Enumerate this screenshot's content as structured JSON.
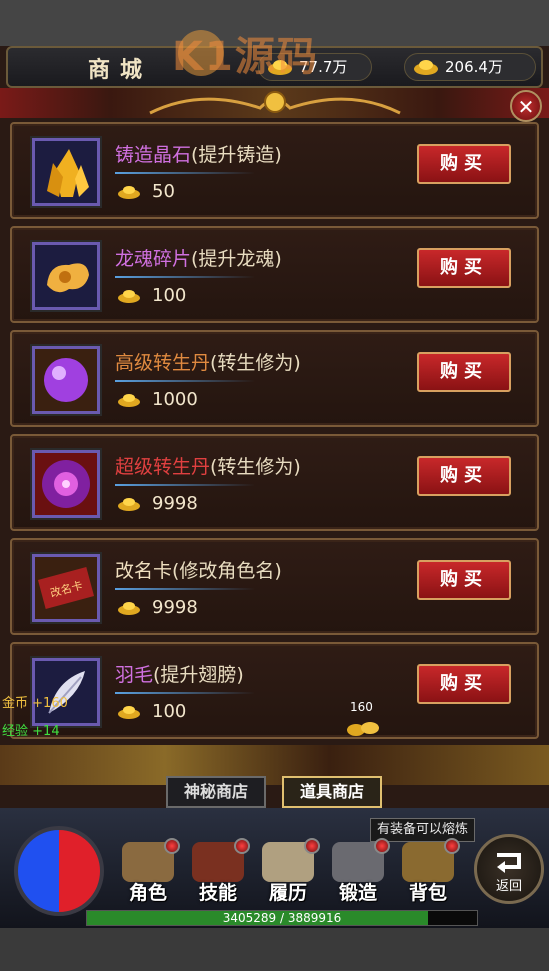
{
  "header": {
    "title": "商城",
    "gold_left": "77.7万",
    "gold_right": "206.4万",
    "watermark": "K1源码"
  },
  "items": [
    {
      "name": "铸造晶石",
      "desc": "(提升铸造)",
      "price": "50",
      "buy": "购买",
      "name_color": "#d070e0",
      "icon": "crystal-icon"
    },
    {
      "name": "龙魂碎片",
      "desc": "(提升龙魂)",
      "price": "100",
      "buy": "购买",
      "name_color": "#d070e0",
      "icon": "dragon-soul-icon"
    },
    {
      "name": "高级转生丹",
      "desc": "(转生修为)",
      "price": "1000",
      "buy": "购买",
      "name_color": "#e08a40",
      "icon": "purple-pill-icon"
    },
    {
      "name": "超级转生丹",
      "desc": "(转生修为)",
      "price": "9998",
      "buy": "购买",
      "name_color": "#e04040",
      "icon": "super-pill-icon"
    },
    {
      "name": "改名卡",
      "desc": "(修改角色名)",
      "price": "9998",
      "buy": "购买",
      "name_color": "#f0e0c0",
      "icon": "rename-card-icon",
      "card_text": "改名卡"
    },
    {
      "name": "羽毛",
      "desc": "(提升翅膀)",
      "price": "100",
      "buy": "购买",
      "name_color": "#d070e0",
      "icon": "feather-icon"
    }
  ],
  "side": {
    "gold_label": "金币",
    "gold_gain": "+160",
    "exp_label": "经验",
    "exp_gain": "+14",
    "drop_amount": "160"
  },
  "tabs": [
    {
      "label": "神秘商店",
      "active": false
    },
    {
      "label": "道具商店",
      "active": true
    }
  ],
  "tooltip": "有装备可以熔炼",
  "menu": [
    {
      "label": "角色",
      "icon": "character-icon"
    },
    {
      "label": "技能",
      "icon": "skill-icon"
    },
    {
      "label": "履历",
      "icon": "history-icon"
    },
    {
      "label": "锻造",
      "icon": "forge-icon"
    },
    {
      "label": "背包",
      "icon": "backpack-icon"
    }
  ],
  "back_label": "返回",
  "xp": {
    "text": "3405289 / 3889916",
    "fraction": 0.875
  }
}
